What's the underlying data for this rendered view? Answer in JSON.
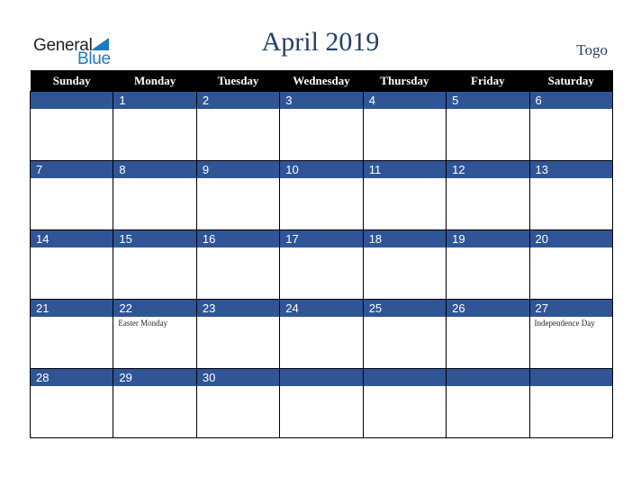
{
  "logo": {
    "line1": "General",
    "line2": "Blue"
  },
  "title": "April 2019",
  "country": "Togo",
  "colors": {
    "band": "#2f5597",
    "header_bg": "#000000",
    "title": "#263e6b",
    "logo_blue": "#1f78c1"
  },
  "weekdays": [
    "Sunday",
    "Monday",
    "Tuesday",
    "Wednesday",
    "Thursday",
    "Friday",
    "Saturday"
  ],
  "weeks": [
    [
      {
        "day": ""
      },
      {
        "day": "1"
      },
      {
        "day": "2"
      },
      {
        "day": "3"
      },
      {
        "day": "4"
      },
      {
        "day": "5"
      },
      {
        "day": "6"
      }
    ],
    [
      {
        "day": "7"
      },
      {
        "day": "8"
      },
      {
        "day": "9"
      },
      {
        "day": "10"
      },
      {
        "day": "11"
      },
      {
        "day": "12"
      },
      {
        "day": "13"
      }
    ],
    [
      {
        "day": "14"
      },
      {
        "day": "15"
      },
      {
        "day": "16"
      },
      {
        "day": "17"
      },
      {
        "day": "18"
      },
      {
        "day": "19"
      },
      {
        "day": "20"
      }
    ],
    [
      {
        "day": "21"
      },
      {
        "day": "22",
        "holiday": "Easter Monday"
      },
      {
        "day": "23"
      },
      {
        "day": "24"
      },
      {
        "day": "25"
      },
      {
        "day": "26"
      },
      {
        "day": "27",
        "holiday": "Independence Day"
      }
    ],
    [
      {
        "day": "28"
      },
      {
        "day": "29"
      },
      {
        "day": "30"
      },
      {
        "day": ""
      },
      {
        "day": ""
      },
      {
        "day": ""
      },
      {
        "day": ""
      }
    ]
  ]
}
